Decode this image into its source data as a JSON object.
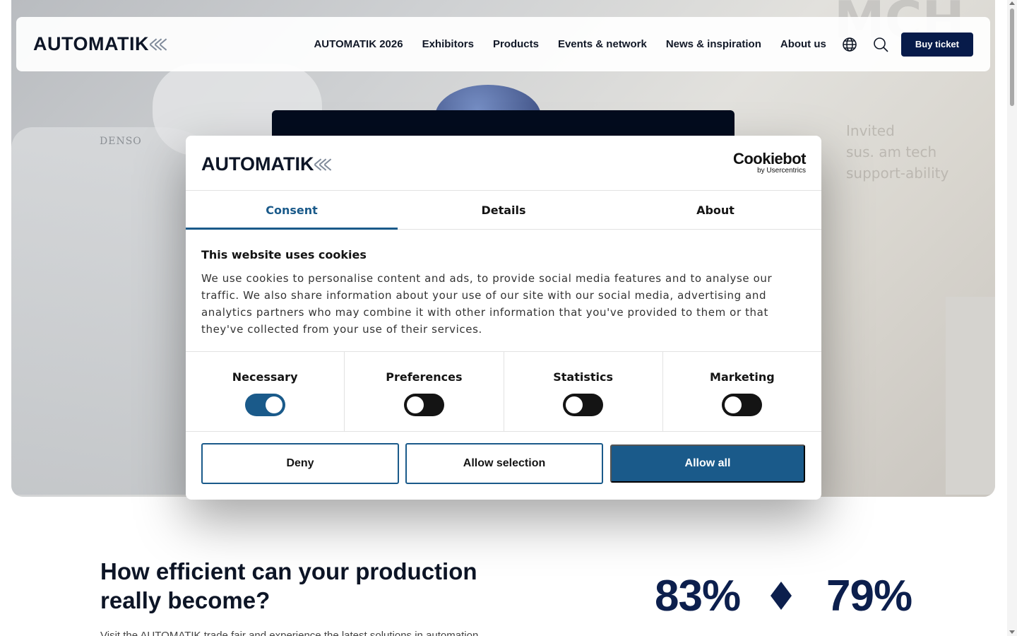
{
  "brand": {
    "name": "AUTOMATIK"
  },
  "nav": {
    "links": [
      "AUTOMATIK 2026",
      "Exhibitors",
      "Products",
      "Events & network",
      "News & inspiration",
      "About us"
    ],
    "buy_label": "Buy ticket"
  },
  "hero": {
    "overlay_text": "Invited\nsus. am tech\nsupport-ability",
    "big_letters": "MCH",
    "machine_brand": "DENSO"
  },
  "cookie": {
    "provider_name": "Cookiebot",
    "provider_by": "by Usercentrics",
    "tabs": [
      "Consent",
      "Details",
      "About"
    ],
    "active_tab": "Consent",
    "heading": "This website uses cookies",
    "body": "We use cookies to personalise content and ads, to provide social media features and to analyse our traffic. We also share information about your use of our site with our social media, advertising and analytics partners who may combine it with other information that you've provided to them or that they've collected from your use of their services.",
    "categories": [
      {
        "label": "Necessary",
        "enabled": true
      },
      {
        "label": "Preferences",
        "enabled": false
      },
      {
        "label": "Statistics",
        "enabled": false
      },
      {
        "label": "Marketing",
        "enabled": false
      }
    ],
    "buttons": {
      "deny": "Deny",
      "allow_selection": "Allow selection",
      "allow_all": "Allow all"
    }
  },
  "section": {
    "title": "How efficient can your production really become?",
    "subtitle": "Visit the AUTOMATIK trade fair and experience the latest solutions in automation",
    "stat_a": "83%",
    "stat_b": "79%"
  },
  "colors": {
    "accent": "#1a5a8a",
    "navy": "#071b4a",
    "stat": "#0c1f4d"
  }
}
